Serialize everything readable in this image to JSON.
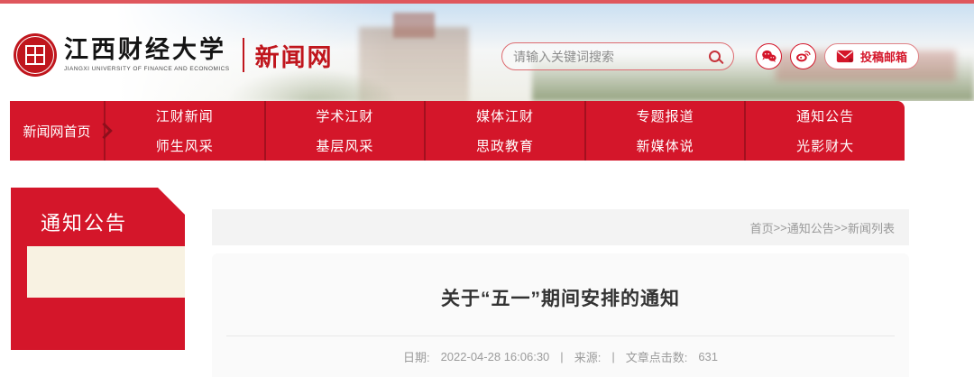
{
  "colors": {
    "primary_red": "#d4162a",
    "nav_divider_red": "#a3101f",
    "logo_red": "#c0161d",
    "topline_pink": "#df575d",
    "sidebar_active_cream": "#f8f2e2",
    "breadcrumb_bg": "#f3f3f3",
    "card_bg": "#fafafa"
  },
  "header": {
    "logo": {
      "seal_icon": "university-seal-icon",
      "university_name": "江西财经大学",
      "university_name_en": "JIANGXI UNIVERSITY OF FINANCE AND ECONOMICS"
    },
    "site_name": "新闻网",
    "search": {
      "placeholder": "请输入关键词搜索",
      "icon": "search-icon"
    },
    "social": {
      "wechat_icon": "wechat-icon",
      "weibo_icon": "weibo-icon"
    },
    "mail_button": {
      "icon": "envelope-icon",
      "label": "投稿邮箱"
    }
  },
  "nav": {
    "home": "新闻网首页",
    "arrow_icon": "chevron-right-icon",
    "columns": [
      {
        "top": "江财新闻",
        "bottom": "师生风采"
      },
      {
        "top": "学术江财",
        "bottom": "基层风采"
      },
      {
        "top": "媒体江财",
        "bottom": "思政教育"
      },
      {
        "top": "专题报道",
        "bottom": "新媒体说"
      },
      {
        "top": "通知公告",
        "bottom": "光影财大"
      }
    ]
  },
  "sidebar": {
    "title": "通知公告"
  },
  "breadcrumb": {
    "home": "首页",
    "separator": ">>",
    "section": "通知公告",
    "current": "新闻列表"
  },
  "article": {
    "title": "关于“五一”期间安排的通知",
    "meta": {
      "date_label": "日期:",
      "date_value": "2022-04-28 16:06:30",
      "separator": "|",
      "source_label": "来源:",
      "clicks_label": "文章点击数:",
      "clicks_value": "631"
    }
  }
}
